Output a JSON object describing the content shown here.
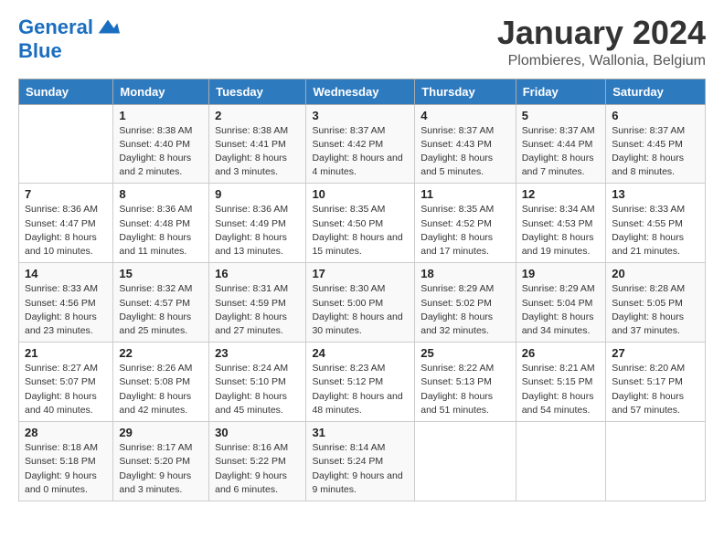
{
  "header": {
    "logo_line1": "General",
    "logo_line2": "Blue",
    "title": "January 2024",
    "subtitle": "Plombieres, Wallonia, Belgium"
  },
  "weekdays": [
    "Sunday",
    "Monday",
    "Tuesday",
    "Wednesday",
    "Thursday",
    "Friday",
    "Saturday"
  ],
  "weeks": [
    [
      {
        "day": "",
        "sunrise": "",
        "sunset": "",
        "daylight": ""
      },
      {
        "day": "1",
        "sunrise": "Sunrise: 8:38 AM",
        "sunset": "Sunset: 4:40 PM",
        "daylight": "Daylight: 8 hours and 2 minutes."
      },
      {
        "day": "2",
        "sunrise": "Sunrise: 8:38 AM",
        "sunset": "Sunset: 4:41 PM",
        "daylight": "Daylight: 8 hours and 3 minutes."
      },
      {
        "day": "3",
        "sunrise": "Sunrise: 8:37 AM",
        "sunset": "Sunset: 4:42 PM",
        "daylight": "Daylight: 8 hours and 4 minutes."
      },
      {
        "day": "4",
        "sunrise": "Sunrise: 8:37 AM",
        "sunset": "Sunset: 4:43 PM",
        "daylight": "Daylight: 8 hours and 5 minutes."
      },
      {
        "day": "5",
        "sunrise": "Sunrise: 8:37 AM",
        "sunset": "Sunset: 4:44 PM",
        "daylight": "Daylight: 8 hours and 7 minutes."
      },
      {
        "day": "6",
        "sunrise": "Sunrise: 8:37 AM",
        "sunset": "Sunset: 4:45 PM",
        "daylight": "Daylight: 8 hours and 8 minutes."
      }
    ],
    [
      {
        "day": "7",
        "sunrise": "Sunrise: 8:36 AM",
        "sunset": "Sunset: 4:47 PM",
        "daylight": "Daylight: 8 hours and 10 minutes."
      },
      {
        "day": "8",
        "sunrise": "Sunrise: 8:36 AM",
        "sunset": "Sunset: 4:48 PM",
        "daylight": "Daylight: 8 hours and 11 minutes."
      },
      {
        "day": "9",
        "sunrise": "Sunrise: 8:36 AM",
        "sunset": "Sunset: 4:49 PM",
        "daylight": "Daylight: 8 hours and 13 minutes."
      },
      {
        "day": "10",
        "sunrise": "Sunrise: 8:35 AM",
        "sunset": "Sunset: 4:50 PM",
        "daylight": "Daylight: 8 hours and 15 minutes."
      },
      {
        "day": "11",
        "sunrise": "Sunrise: 8:35 AM",
        "sunset": "Sunset: 4:52 PM",
        "daylight": "Daylight: 8 hours and 17 minutes."
      },
      {
        "day": "12",
        "sunrise": "Sunrise: 8:34 AM",
        "sunset": "Sunset: 4:53 PM",
        "daylight": "Daylight: 8 hours and 19 minutes."
      },
      {
        "day": "13",
        "sunrise": "Sunrise: 8:33 AM",
        "sunset": "Sunset: 4:55 PM",
        "daylight": "Daylight: 8 hours and 21 minutes."
      }
    ],
    [
      {
        "day": "14",
        "sunrise": "Sunrise: 8:33 AM",
        "sunset": "Sunset: 4:56 PM",
        "daylight": "Daylight: 8 hours and 23 minutes."
      },
      {
        "day": "15",
        "sunrise": "Sunrise: 8:32 AM",
        "sunset": "Sunset: 4:57 PM",
        "daylight": "Daylight: 8 hours and 25 minutes."
      },
      {
        "day": "16",
        "sunrise": "Sunrise: 8:31 AM",
        "sunset": "Sunset: 4:59 PM",
        "daylight": "Daylight: 8 hours and 27 minutes."
      },
      {
        "day": "17",
        "sunrise": "Sunrise: 8:30 AM",
        "sunset": "Sunset: 5:00 PM",
        "daylight": "Daylight: 8 hours and 30 minutes."
      },
      {
        "day": "18",
        "sunrise": "Sunrise: 8:29 AM",
        "sunset": "Sunset: 5:02 PM",
        "daylight": "Daylight: 8 hours and 32 minutes."
      },
      {
        "day": "19",
        "sunrise": "Sunrise: 8:29 AM",
        "sunset": "Sunset: 5:04 PM",
        "daylight": "Daylight: 8 hours and 34 minutes."
      },
      {
        "day": "20",
        "sunrise": "Sunrise: 8:28 AM",
        "sunset": "Sunset: 5:05 PM",
        "daylight": "Daylight: 8 hours and 37 minutes."
      }
    ],
    [
      {
        "day": "21",
        "sunrise": "Sunrise: 8:27 AM",
        "sunset": "Sunset: 5:07 PM",
        "daylight": "Daylight: 8 hours and 40 minutes."
      },
      {
        "day": "22",
        "sunrise": "Sunrise: 8:26 AM",
        "sunset": "Sunset: 5:08 PM",
        "daylight": "Daylight: 8 hours and 42 minutes."
      },
      {
        "day": "23",
        "sunrise": "Sunrise: 8:24 AM",
        "sunset": "Sunset: 5:10 PM",
        "daylight": "Daylight: 8 hours and 45 minutes."
      },
      {
        "day": "24",
        "sunrise": "Sunrise: 8:23 AM",
        "sunset": "Sunset: 5:12 PM",
        "daylight": "Daylight: 8 hours and 48 minutes."
      },
      {
        "day": "25",
        "sunrise": "Sunrise: 8:22 AM",
        "sunset": "Sunset: 5:13 PM",
        "daylight": "Daylight: 8 hours and 51 minutes."
      },
      {
        "day": "26",
        "sunrise": "Sunrise: 8:21 AM",
        "sunset": "Sunset: 5:15 PM",
        "daylight": "Daylight: 8 hours and 54 minutes."
      },
      {
        "day": "27",
        "sunrise": "Sunrise: 8:20 AM",
        "sunset": "Sunset: 5:17 PM",
        "daylight": "Daylight: 8 hours and 57 minutes."
      }
    ],
    [
      {
        "day": "28",
        "sunrise": "Sunrise: 8:18 AM",
        "sunset": "Sunset: 5:18 PM",
        "daylight": "Daylight: 9 hours and 0 minutes."
      },
      {
        "day": "29",
        "sunrise": "Sunrise: 8:17 AM",
        "sunset": "Sunset: 5:20 PM",
        "daylight": "Daylight: 9 hours and 3 minutes."
      },
      {
        "day": "30",
        "sunrise": "Sunrise: 8:16 AM",
        "sunset": "Sunset: 5:22 PM",
        "daylight": "Daylight: 9 hours and 6 minutes."
      },
      {
        "day": "31",
        "sunrise": "Sunrise: 8:14 AM",
        "sunset": "Sunset: 5:24 PM",
        "daylight": "Daylight: 9 hours and 9 minutes."
      },
      {
        "day": "",
        "sunrise": "",
        "sunset": "",
        "daylight": ""
      },
      {
        "day": "",
        "sunrise": "",
        "sunset": "",
        "daylight": ""
      },
      {
        "day": "",
        "sunrise": "",
        "sunset": "",
        "daylight": ""
      }
    ]
  ]
}
